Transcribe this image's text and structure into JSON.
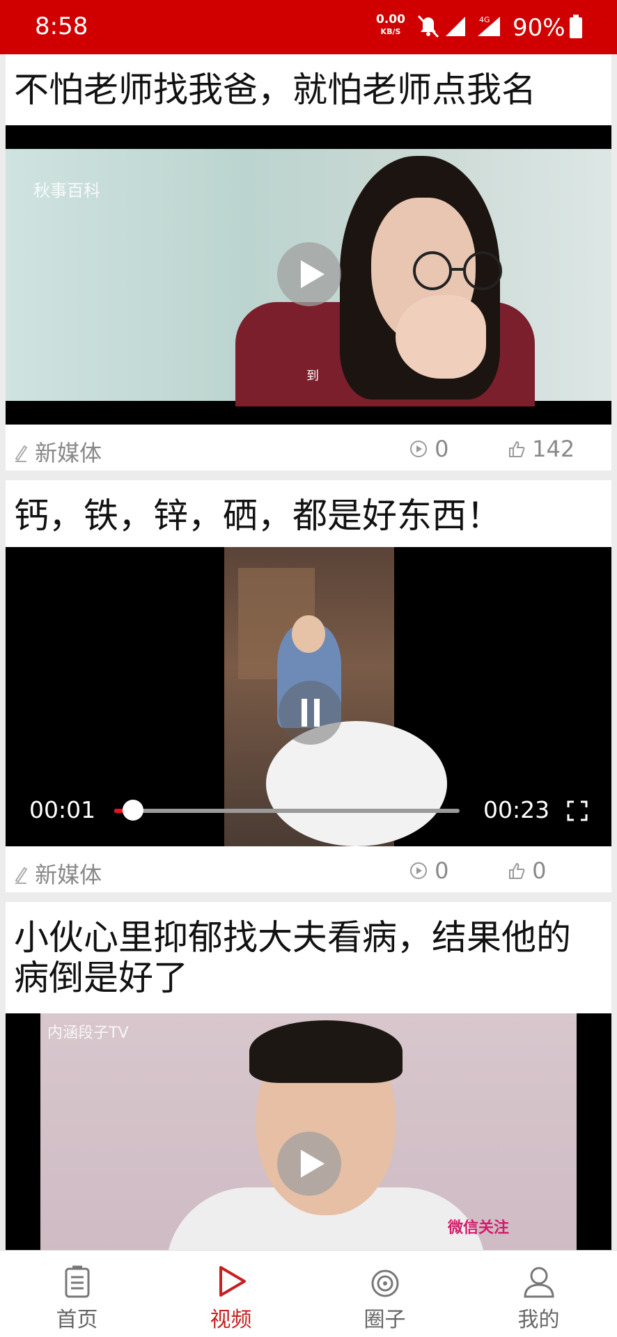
{
  "status_bar": {
    "time": "8:58",
    "net_speed": "0.00",
    "net_unit": "KB/S",
    "network": "4G",
    "battery": "90%"
  },
  "feed": [
    {
      "title": "不怕老师找我爸，就怕老师点我名",
      "author": "新媒体",
      "views": "0",
      "likes": "142",
      "watermark": "秋事百科",
      "subtitle": "到",
      "state": "paused-thumbnail"
    },
    {
      "title": "钙，铁，锌，硒，都是好东西！",
      "author": "新媒体",
      "views": "0",
      "likes": "0",
      "state": "playing",
      "current_time": "00:01",
      "duration": "00:23",
      "progress": 0.04
    },
    {
      "title": "小伙心里抑郁找大夫看病，结果他的病倒是好了",
      "watermark": "内涵段子TV",
      "overlay_text": "微信关注",
      "state": "paused-thumbnail"
    }
  ],
  "tabs": [
    {
      "label": "首页",
      "icon": "home-doc-icon",
      "active": false
    },
    {
      "label": "视频",
      "icon": "video-play-icon",
      "active": true
    },
    {
      "label": "圈子",
      "icon": "circle-target-icon",
      "active": false
    },
    {
      "label": "我的",
      "icon": "user-profile-icon",
      "active": false
    }
  ],
  "colors": {
    "accent": "#d00000",
    "active_tab": "#c81f1f",
    "meta_text": "#888888"
  }
}
